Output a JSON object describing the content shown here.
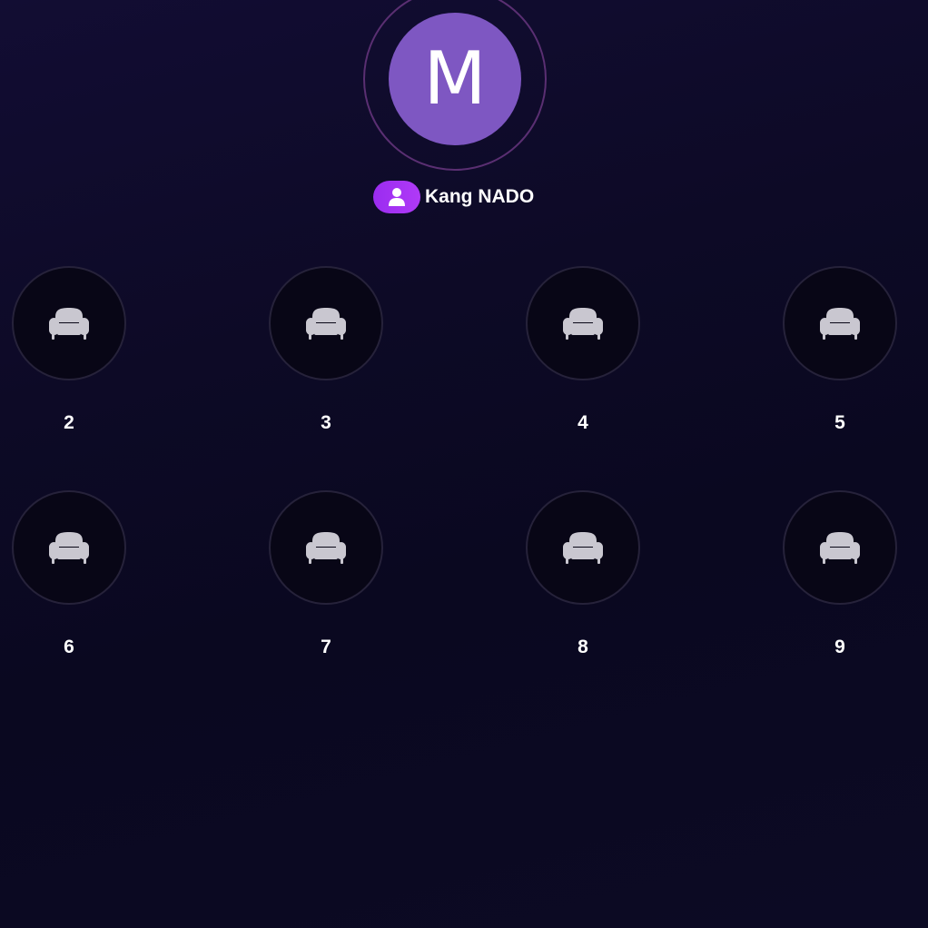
{
  "host": {
    "avatar_initial": "M",
    "name": "Kang NADO",
    "badge_icon": "user-icon",
    "avatar_color": "#7e57c2",
    "badge_color": "#a533f5"
  },
  "seats": [
    {
      "number": "2",
      "icon": "armchair-icon"
    },
    {
      "number": "3",
      "icon": "armchair-icon"
    },
    {
      "number": "4",
      "icon": "armchair-icon"
    },
    {
      "number": "5",
      "icon": "armchair-icon"
    },
    {
      "number": "6",
      "icon": "armchair-icon"
    },
    {
      "number": "7",
      "icon": "armchair-icon"
    },
    {
      "number": "8",
      "icon": "armchair-icon"
    },
    {
      "number": "9",
      "icon": "armchair-icon"
    }
  ]
}
